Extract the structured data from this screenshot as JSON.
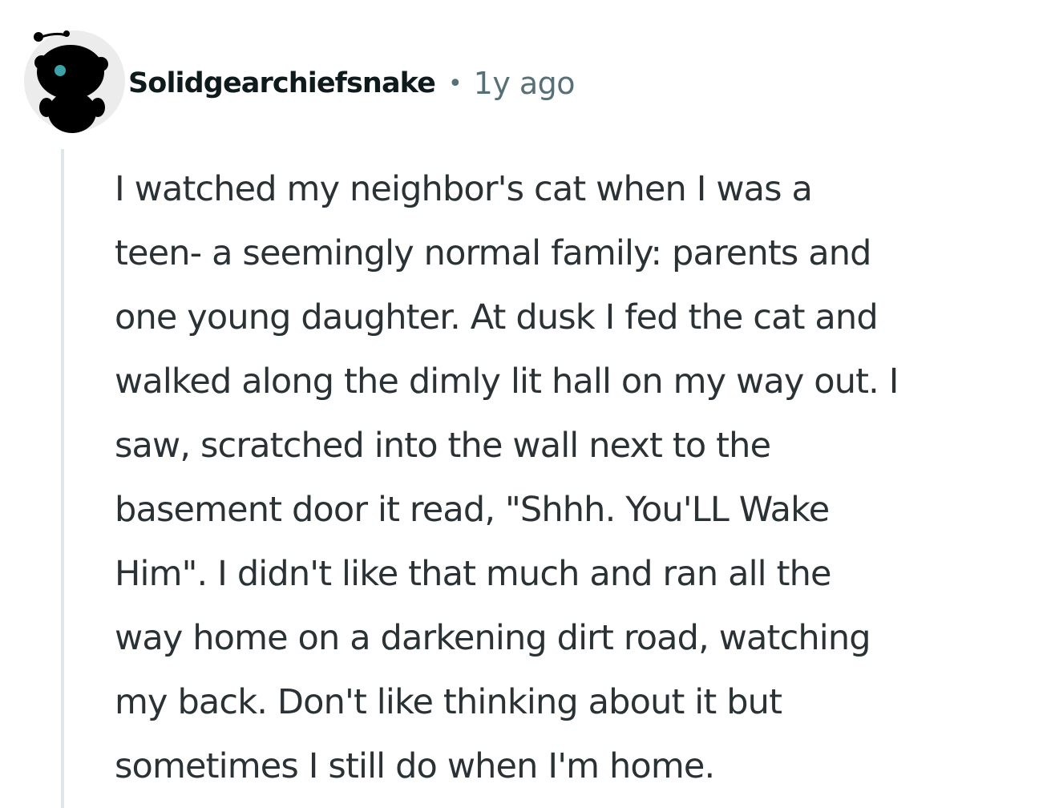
{
  "comment": {
    "author": "Solidgearchiefsnake",
    "separator": "•",
    "timestamp": "1y ago",
    "body_lines": [
      "I watched my neighbor's cat when I was a",
      "teen- a seemingly normal family: parents and",
      "one young daughter. At dusk I fed the cat and",
      "walked along the dimly lit hall on my way out. I",
      "saw, scratched into the wall next to the",
      "basement door it read, \"Shhh. You'LL Wake",
      "Him\". I didn't like that much and ran all the",
      "way home on a darkening dirt road, watching",
      "my back. Don't like thinking about it but",
      "sometimes I still do when I'm home."
    ]
  },
  "avatar": {
    "icon": "snoo-avatar-icon",
    "background": "#ececec",
    "figure_color": "#000000",
    "eye_color": "#3ba3a8"
  },
  "colors": {
    "username": "#0f1a1c",
    "meta": "#576f76",
    "body": "#2a3236",
    "thread_line": "#dfe6ea"
  }
}
